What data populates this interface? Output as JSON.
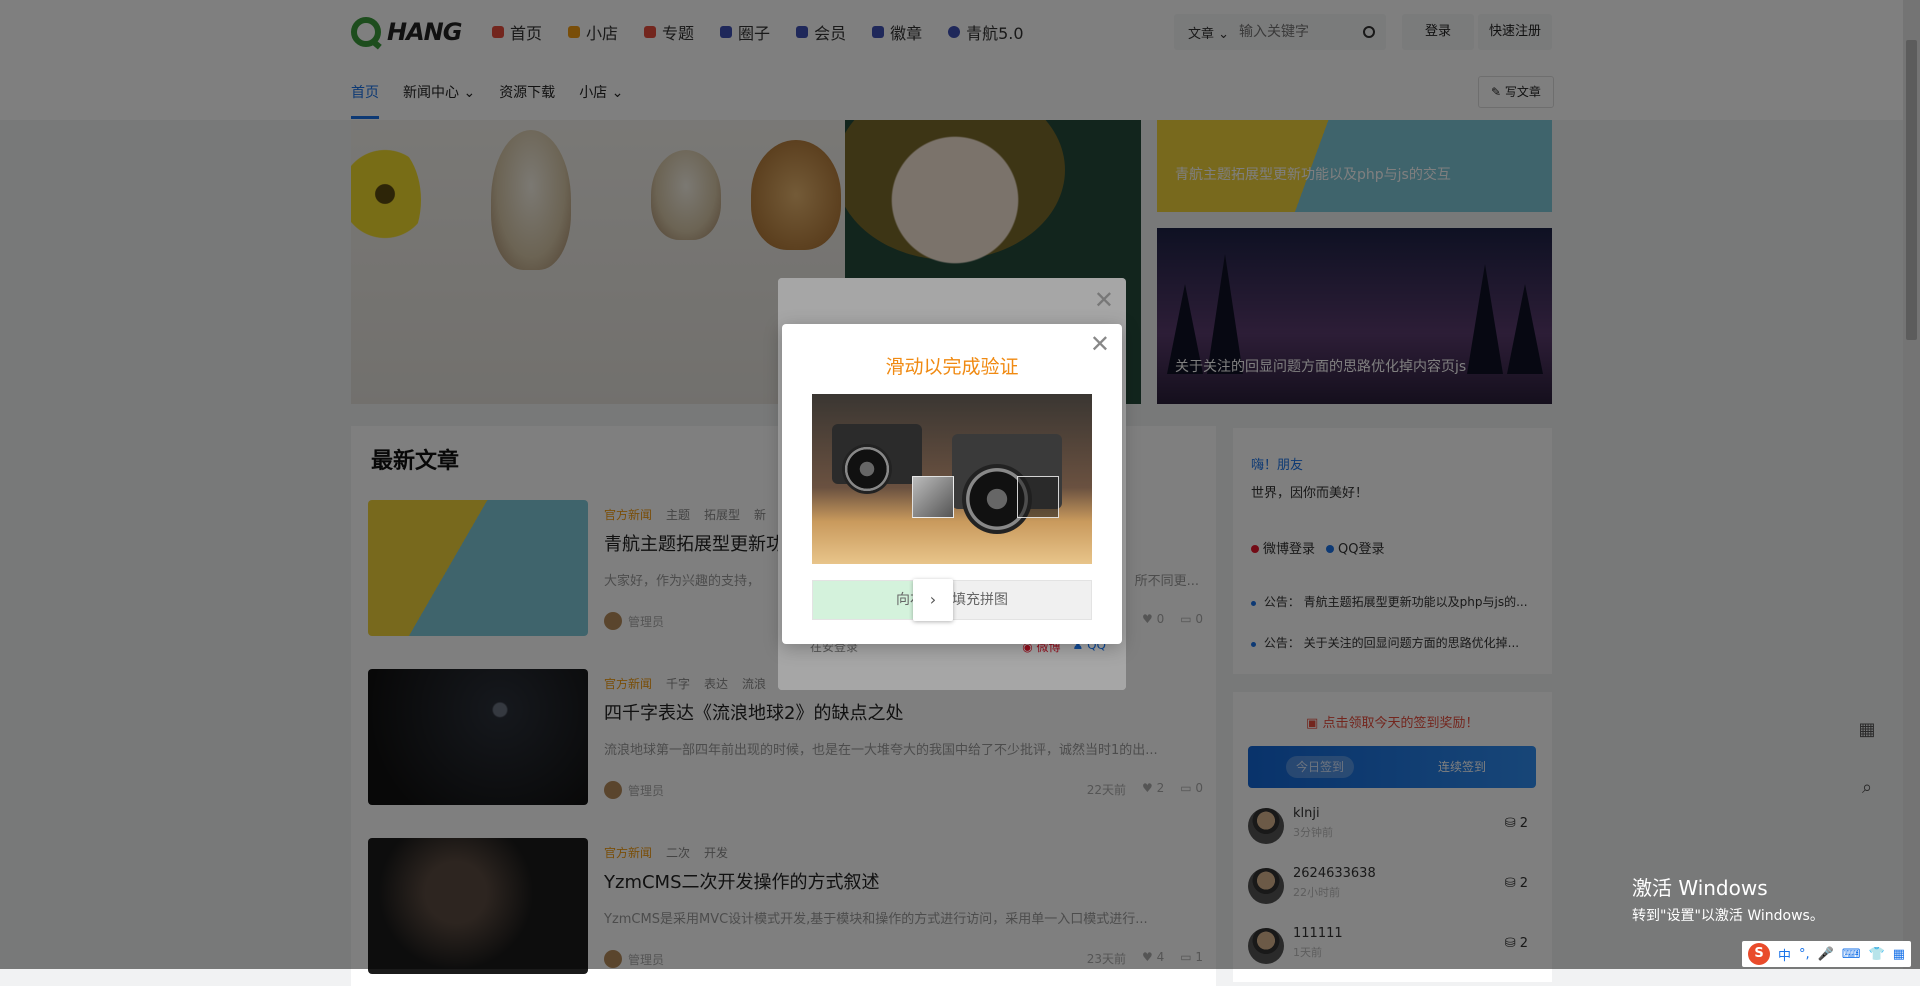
{
  "logo": {
    "text": "HANG"
  },
  "nav": [
    {
      "label": "首页",
      "color": "#e74c3c"
    },
    {
      "label": "小店",
      "color": "#f39c12"
    },
    {
      "label": "专题",
      "color": "#e74c3c"
    },
    {
      "label": "圈子",
      "color": "#3f51b5"
    },
    {
      "label": "会员",
      "color": "#3f51b5"
    },
    {
      "label": "徽章",
      "color": "#3f51b5"
    },
    {
      "label": "青航5.0",
      "color": "#3f51b5"
    }
  ],
  "search": {
    "type_label": "文章",
    "placeholder": "输入关键字"
  },
  "header": {
    "login": "登录",
    "register": "快速注册",
    "write": "写文章"
  },
  "subnav": [
    "首页",
    "新闻中心",
    "资源下载",
    "小店"
  ],
  "hero": {
    "right_top_title": "青航主题拓展型更新功能以及php与js的交互",
    "right_bottom_title": "关于关注的回显问题方面的思路优化掉内容页js"
  },
  "main": {
    "heading": "最新文章",
    "articles": [
      {
        "tags": [
          "官方新闻",
          "主题",
          "拓展型",
          "新"
        ],
        "title": "青航主题拓展型更新功",
        "excerpt": "大家好，作为兴趣的支持，",
        "excerpt_tail": "所不同更...",
        "author": "管理员",
        "time": "",
        "likes": "0",
        "comments": "0"
      },
      {
        "tags": [
          "官方新闻",
          "千字",
          "表达",
          "流浪"
        ],
        "title": "四千字表达《流浪地球2》的缺点之处",
        "excerpt": "流浪地球第一部四年前出现的时候，也是在一大堆夸大的我国中给了不少批评，诚然当时1的出...",
        "excerpt_tail": "",
        "author": "管理员",
        "time": "22天前",
        "likes": "2",
        "comments": "0"
      },
      {
        "tags": [
          "官方新闻",
          "二次",
          "开发"
        ],
        "title": "YzmCMS二次开发操作的方式叙述",
        "excerpt": "YzmCMS是采用MVC设计模式开发,基于模块和操作的方式进行访问，采用单一入口模式进行...",
        "excerpt_tail": "",
        "author": "管理员",
        "time": "23天前",
        "likes": "4",
        "comments": "1"
      }
    ]
  },
  "sidebar": {
    "greeting": "嗨！朋友",
    "motto": "世界，因你而美好！",
    "weibo_login": "微博登录",
    "qq_login": "QQ登录",
    "notices": [
      "公告：  青航主题拓展型更新功能以及php与js的...",
      "公告：  关于关注的回显问题方面的思路优化掉..."
    ],
    "signin_prompt": "点击领取今天的签到奖励！",
    "today_sign": "今日签到",
    "continuous_sign": "连续签到",
    "users": [
      {
        "name": "klnji",
        "time": "3分钟前",
        "count": "2"
      },
      {
        "name": "2624633638",
        "time": "22小时前",
        "count": "2"
      },
      {
        "name": "111111",
        "time": "1天前",
        "count": "2"
      }
    ]
  },
  "login_modal": {
    "bottom_left": "在安登录",
    "weibo": "微博",
    "qq": "QQ"
  },
  "captcha": {
    "title": "滑动以完成验证",
    "hint": "向右滑动填充拼图",
    "knob": "›"
  },
  "windows": {
    "line1": "激活 Windows",
    "line2": "转到\"设置\"以激活 Windows。"
  },
  "ime": {
    "logo": "S",
    "lang": "中"
  }
}
